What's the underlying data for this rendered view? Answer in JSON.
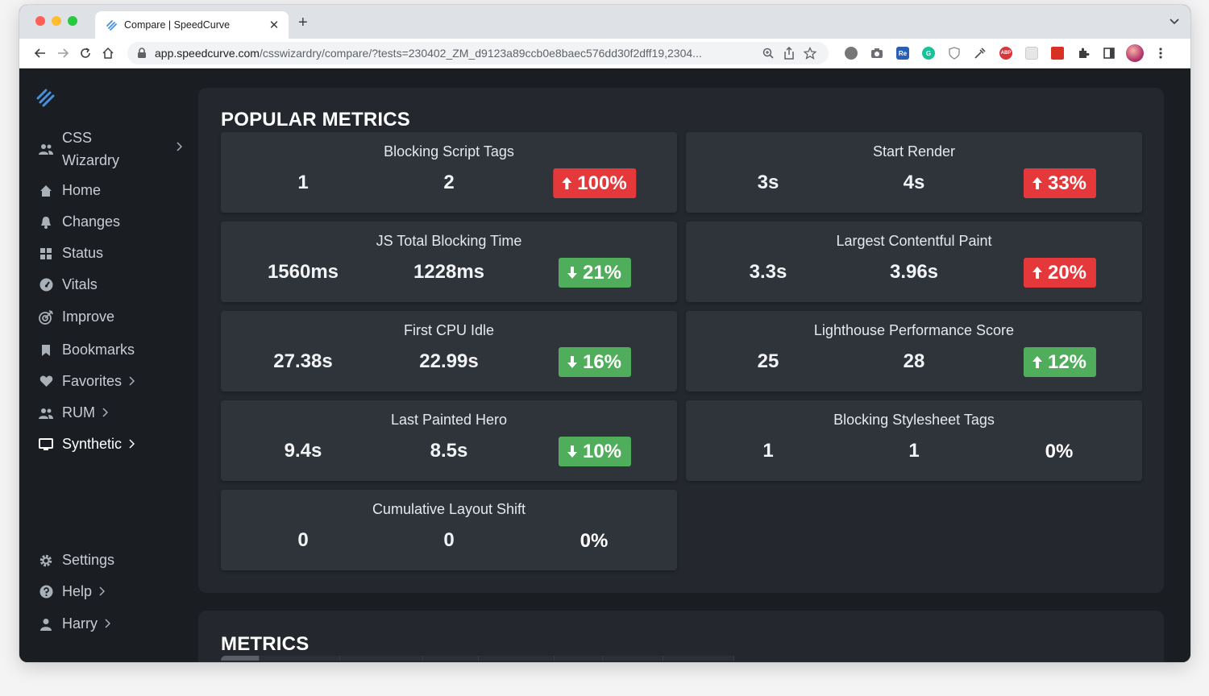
{
  "browser": {
    "tab_title": "Compare | SpeedCurve",
    "tab_close": "✕",
    "new_tab": "+",
    "url_host": "app.speedcurve.com",
    "url_path": "/csswizardry/compare/?tests=230402_ZM_d9123a89ccb0e8baec576dd30f2dff19,2304..."
  },
  "sidebar": {
    "workspace": "CSS Wizardry",
    "items": [
      {
        "label": "Home",
        "icon": "home-icon"
      },
      {
        "label": "Changes",
        "icon": "bell-icon"
      },
      {
        "label": "Status",
        "icon": "grid-icon"
      },
      {
        "label": "Vitals",
        "icon": "gauge-icon"
      },
      {
        "label": "Improve",
        "icon": "target-icon"
      },
      {
        "label": "Bookmarks",
        "icon": "bookmark-icon"
      },
      {
        "label": "Favorites",
        "icon": "heart-icon"
      },
      {
        "label": "RUM",
        "icon": "users-icon"
      },
      {
        "label": "Synthetic",
        "icon": "monitor-icon"
      }
    ],
    "bottom": [
      {
        "label": "Settings",
        "icon": "gear-icon"
      },
      {
        "label": "Help",
        "icon": "help-icon"
      },
      {
        "label": "Harry",
        "icon": "user-icon"
      }
    ]
  },
  "popular": {
    "title": "POPULAR METRICS",
    "cards": [
      {
        "title": "Blocking Script Tags",
        "a": "1",
        "b": "2",
        "change": "100%",
        "direction": "up",
        "status": "worse"
      },
      {
        "title": "Start Render",
        "a": "3s",
        "b": "4s",
        "change": "33%",
        "direction": "up",
        "status": "worse"
      },
      {
        "title": "JS Total Blocking Time",
        "a": "1560ms",
        "b": "1228ms",
        "change": "21%",
        "direction": "down",
        "status": "better"
      },
      {
        "title": "Largest Contentful Paint",
        "a": "3.3s",
        "b": "3.96s",
        "change": "20%",
        "direction": "up",
        "status": "worse"
      },
      {
        "title": "First CPU Idle",
        "a": "27.38s",
        "b": "22.99s",
        "change": "16%",
        "direction": "down",
        "status": "better"
      },
      {
        "title": "Lighthouse Performance Score",
        "a": "25",
        "b": "28",
        "change": "12%",
        "direction": "up",
        "status": "better"
      },
      {
        "title": "Last Painted Hero",
        "a": "9.4s",
        "b": "8.5s",
        "change": "10%",
        "direction": "down",
        "status": "better"
      },
      {
        "title": "Blocking Stylesheet Tags",
        "a": "1",
        "b": "1",
        "change": "0%",
        "direction": "none",
        "status": "neutral"
      },
      {
        "title": "Cumulative Layout Shift",
        "a": "0",
        "b": "0",
        "change": "0%",
        "direction": "none",
        "status": "neutral"
      }
    ]
  },
  "metrics": {
    "title": "METRICS"
  },
  "colors": {
    "worse": "#e5383b",
    "better": "#4fad5b",
    "background": "#1a1d21",
    "panel": "#24282e",
    "card": "#2f343b"
  }
}
